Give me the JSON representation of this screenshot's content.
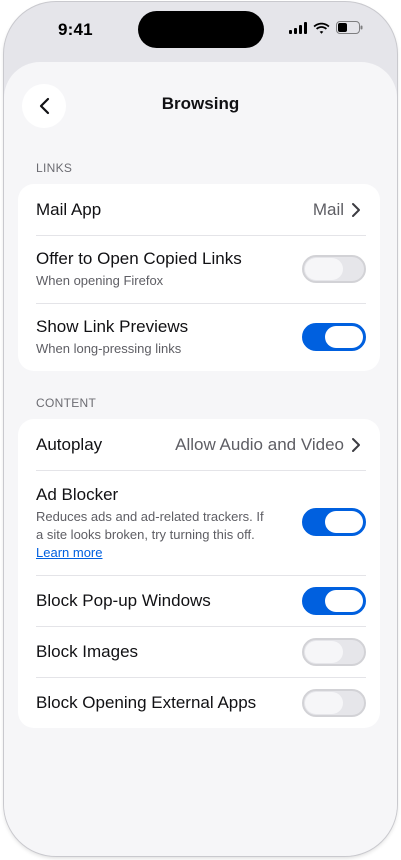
{
  "status_bar": {
    "time": "9:41"
  },
  "nav": {
    "title": "Browsing"
  },
  "sections": [
    {
      "header": "LINKS",
      "rows": [
        {
          "title": "Mail App",
          "value": "Mail"
        },
        {
          "title": "Offer to Open Copied Links",
          "subtitle": "When opening Firefox",
          "toggle_on": false
        },
        {
          "title": "Show Link Previews",
          "subtitle": "When long-pressing links",
          "toggle_on": true
        }
      ]
    },
    {
      "header": "CONTENT",
      "rows": [
        {
          "title": "Autoplay",
          "value": "Allow Audio and Video"
        },
        {
          "title": "Ad Blocker",
          "subtitle_line1": "Reduces ads and ad-related trackers. If",
          "subtitle_line2": "a site looks broken, try turning this off.",
          "link": "Learn more",
          "toggle_on": true
        },
        {
          "title": "Block Pop-up Windows",
          "toggle_on": true
        },
        {
          "title": "Block Images",
          "toggle_on": false
        },
        {
          "title": "Block Opening External Apps",
          "toggle_on": false
        }
      ]
    }
  ],
  "colors": {
    "accent": "#0060df",
    "background": "#f6f6f8",
    "card": "#ffffff"
  },
  "icons": {
    "back": "chevron-left-icon",
    "disclosure": "chevron-right-icon",
    "signal": "cellular-signal-icon",
    "wifi": "wifi-icon",
    "battery": "battery-icon"
  }
}
